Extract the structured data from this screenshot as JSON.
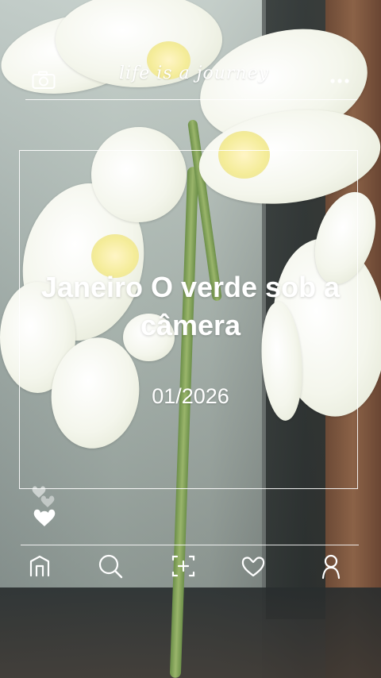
{
  "header": {
    "brand": "life is a journey",
    "icons": {
      "left": "camera-icon",
      "right": "more-icon"
    }
  },
  "card": {
    "title": "Janeiro O verde sob a câmera",
    "date": "01/2026"
  },
  "reactions": {
    "icon": "heart-icon"
  },
  "nav": {
    "items": [
      {
        "name": "home",
        "icon": "home-icon"
      },
      {
        "name": "search",
        "icon": "search-icon"
      },
      {
        "name": "add",
        "icon": "add-photo-icon"
      },
      {
        "name": "favorites",
        "icon": "heart-icon"
      },
      {
        "name": "profile",
        "icon": "profile-icon"
      }
    ]
  },
  "colors": {
    "overlay_text": "#ffffff"
  }
}
